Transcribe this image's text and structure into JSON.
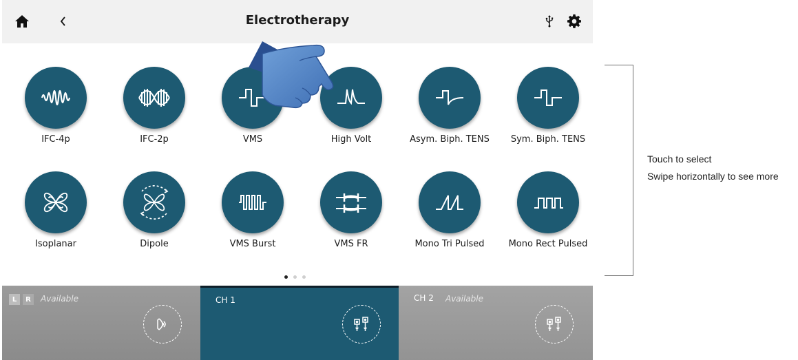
{
  "header": {
    "title": "Electrotherapy",
    "icons": [
      "home-icon",
      "back-icon",
      "usb-icon",
      "gear-icon"
    ]
  },
  "programs": {
    "row1": [
      {
        "label": "IFC-4p",
        "icon": "ifc-4p-waveform"
      },
      {
        "label": "IFC-2p",
        "icon": "ifc-2p-waveform"
      },
      {
        "label": "VMS",
        "icon": "vms-waveform"
      },
      {
        "label": "High Volt",
        "icon": "high-volt-waveform"
      },
      {
        "label": "Asym. Biph. TENS",
        "icon": "asym-biph-waveform"
      },
      {
        "label": "Sym. Biph. TENS",
        "icon": "sym-biph-waveform"
      }
    ],
    "row2": [
      {
        "label": "Isoplanar",
        "icon": "isoplanar-flower"
      },
      {
        "label": "Dipole",
        "icon": "dipole-flower"
      },
      {
        "label": "VMS Burst",
        "icon": "vms-burst-waveform"
      },
      {
        "label": "VMS FR",
        "icon": "vms-fr-waveform"
      },
      {
        "label": "Mono Tri Pulsed",
        "icon": "mono-tri-waveform"
      },
      {
        "label": "Mono Rect Pulsed",
        "icon": "mono-rect-waveform"
      }
    ]
  },
  "pagination": {
    "pages": 3,
    "current": 1
  },
  "channels": {
    "lr": {
      "left": "L",
      "right": "R",
      "status": "Available",
      "icon": "ultrasound-head-icon"
    },
    "ch1": {
      "name": "CH 1",
      "icon": "electrodes-icon",
      "selected": true
    },
    "ch2": {
      "name": "CH 2",
      "status": "Available",
      "icon": "electrodes-icon"
    }
  },
  "annotation": {
    "line1": "Touch to select",
    "line2": "Swipe horizontally to see more"
  },
  "colors": {
    "accent": "#1d5a72",
    "header_bg": "#f1f1f1",
    "inactive_panel": "#959595"
  }
}
